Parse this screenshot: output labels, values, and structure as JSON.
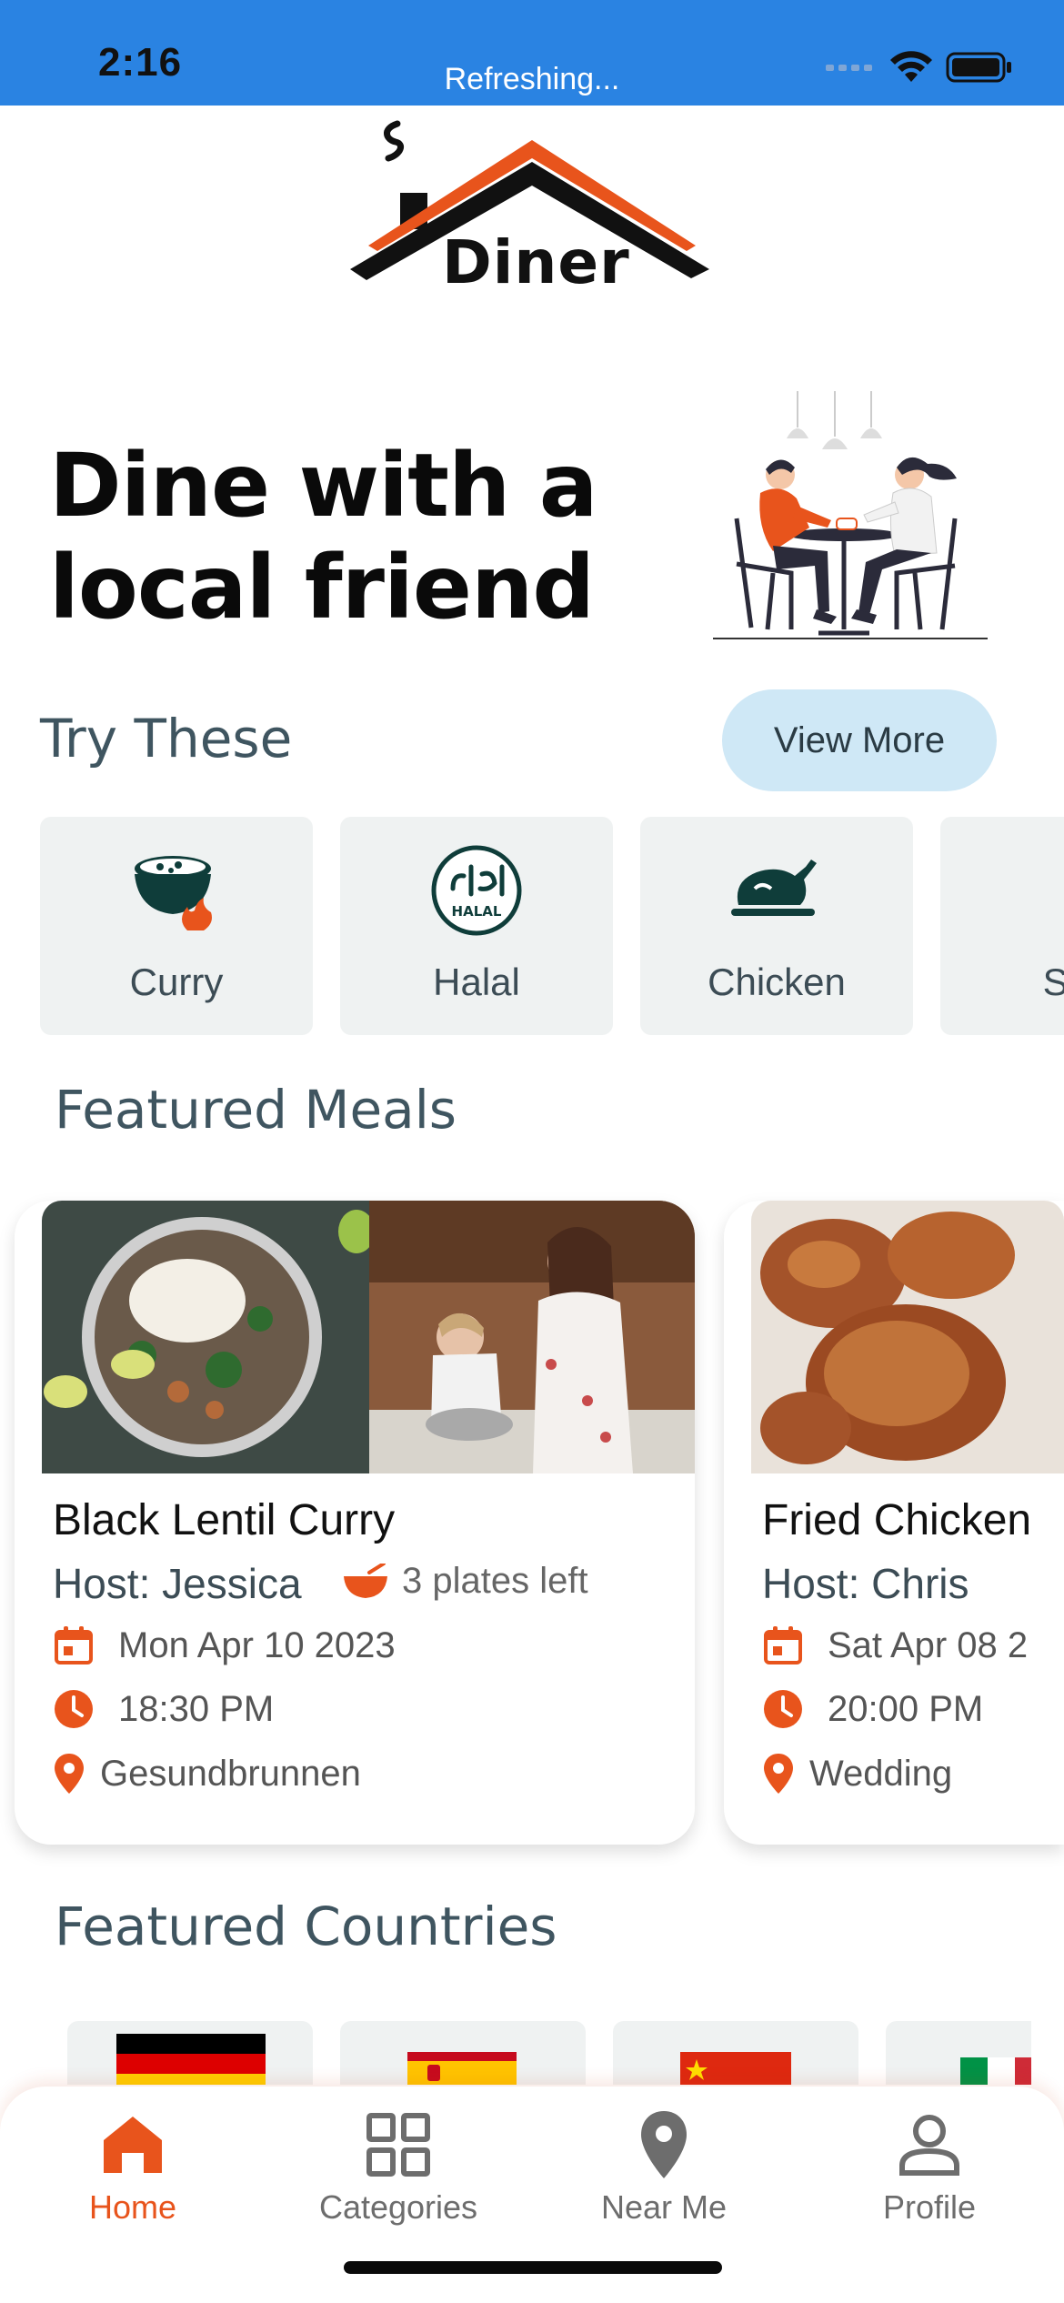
{
  "status_bar": {
    "time": "2:16",
    "message": "Refreshing..."
  },
  "logo": {
    "text": "Diner"
  },
  "hero": {
    "title": "Dine with a local friend"
  },
  "try_these": {
    "title": "Try These",
    "view_more_label": "View More",
    "categories": [
      {
        "label": "Curry",
        "icon": "curry-bowl-icon"
      },
      {
        "label": "Halal",
        "icon": "halal-icon"
      },
      {
        "label": "Chicken",
        "icon": "roast-chicken-icon"
      },
      {
        "label": "Sea",
        "icon": "seafood-icon"
      }
    ]
  },
  "featured_meals": {
    "title": "Featured Meals",
    "meals": [
      {
        "name": "Black Lentil Curry",
        "host": "Host: Jessica",
        "plates_left": "3 plates left",
        "date": "Mon Apr 10 2023",
        "time": "18:30 PM",
        "location": "Gesundbrunnen"
      },
      {
        "name": "Fried Chicken",
        "host": "Host: Chris",
        "date": "Sat Apr 08 2",
        "time": "20:00 PM",
        "location": "Wedding"
      }
    ]
  },
  "featured_countries": {
    "title": "Featured Countries",
    "flags": [
      "germany-flag",
      "spain-flag",
      "china-flag",
      "italy-flag"
    ]
  },
  "bottom_nav": {
    "items": [
      {
        "label": "Home",
        "icon": "home-icon",
        "active": true
      },
      {
        "label": "Categories",
        "icon": "grid-icon",
        "active": false
      },
      {
        "label": "Near Me",
        "icon": "location-pin-icon",
        "active": false
      },
      {
        "label": "Profile",
        "icon": "person-icon",
        "active": false
      }
    ]
  },
  "colors": {
    "status_bar": "#2a83e2",
    "accent": "#e8541c",
    "heading": "#3f5560",
    "view_more_bg": "#cfe8f6",
    "card_bg": "#eff2f2"
  }
}
